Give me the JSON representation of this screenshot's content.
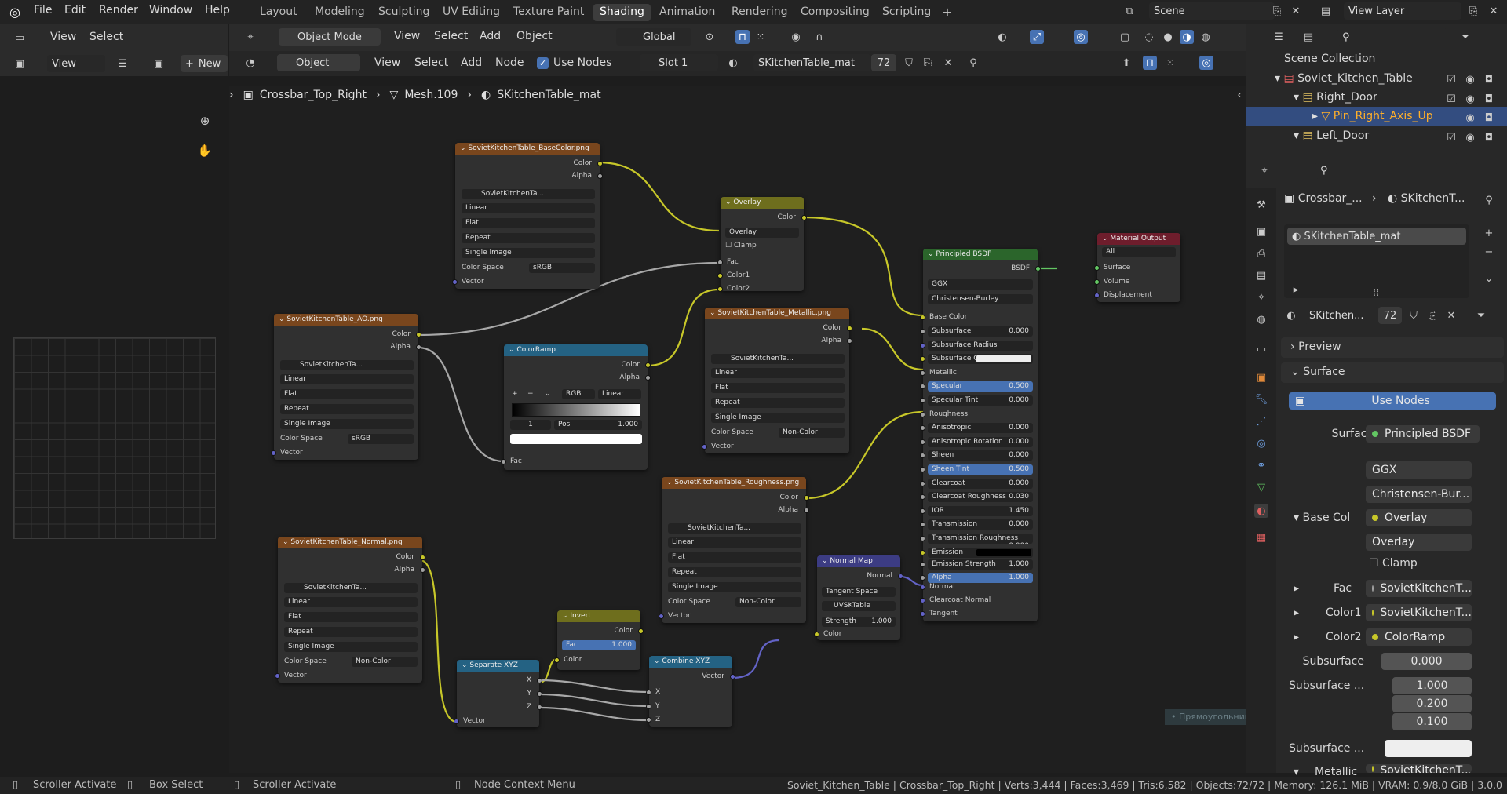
{
  "top_menu": [
    "File",
    "Edit",
    "Render",
    "Window",
    "Help"
  ],
  "workspaces": [
    "Layout",
    "Modeling",
    "Sculpting",
    "UV Editing",
    "Texture Paint",
    "Shading",
    "Animation",
    "Rendering",
    "Compositing",
    "Scripting"
  ],
  "active_workspace": "Shading",
  "scene": "Scene",
  "view_layer": "View Layer",
  "left_header": {
    "view": "View",
    "select": "Select",
    "view2": "View",
    "new": "New"
  },
  "viewport_header": {
    "mode": "Object Mode",
    "menus": [
      "View",
      "Select",
      "Add",
      "Object"
    ],
    "transform": "Global"
  },
  "node_header": {
    "type": "Object",
    "menus": [
      "View",
      "Select",
      "Add",
      "Node"
    ],
    "use_nodes": "Use Nodes",
    "slot": "Slot 1",
    "material": "SKitchenTable_mat",
    "users": "72"
  },
  "breadcrumb": {
    "object": "Crossbar_Top_Right",
    "mesh": "Mesh.109",
    "material": "SKitchenTable_mat"
  },
  "nodes": {
    "basecolor": {
      "title": "SovietKitchenTable_BaseColor.png",
      "out1": "Color",
      "out2": "Alpha",
      "img": "SovietKitchenTa...",
      "interp": "Linear",
      "proj": "Flat",
      "ext": "Repeat",
      "src": "Single Image",
      "cs_label": "Color Space",
      "cs": "sRGB",
      "vec": "Vector"
    },
    "ao": {
      "title": "SovietKitchenTable_AO.png",
      "out1": "Color",
      "out2": "Alpha",
      "img": "SovietKitchenTa...",
      "interp": "Linear",
      "proj": "Flat",
      "ext": "Repeat",
      "src": "Single Image",
      "cs_label": "Color Space",
      "cs": "sRGB",
      "vec": "Vector"
    },
    "normal": {
      "title": "SovietKitchenTable_Normal.png",
      "out1": "Color",
      "out2": "Alpha",
      "img": "SovietKitchenTa...",
      "interp": "Linear",
      "proj": "Flat",
      "ext": "Repeat",
      "src": "Single Image",
      "cs_label": "Color Space",
      "cs": "Non-Color",
      "vec": "Vector"
    },
    "metallic": {
      "title": "SovietKitchenTable_Metallic.png",
      "out1": "Color",
      "out2": "Alpha",
      "img": "SovietKitchenTa...",
      "interp": "Linear",
      "proj": "Flat",
      "ext": "Repeat",
      "src": "Single Image",
      "cs_label": "Color Space",
      "cs": "Non-Color",
      "vec": "Vector"
    },
    "roughness": {
      "title": "SovietKitchenTable_Roughness.png",
      "out1": "Color",
      "out2": "Alpha",
      "img": "SovietKitchenTa...",
      "interp": "Linear",
      "proj": "Flat",
      "ext": "Repeat",
      "src": "Single Image",
      "cs_label": "Color Space",
      "cs": "Non-Color",
      "vec": "Vector"
    },
    "overlay": {
      "title": "Overlay",
      "out": "Color",
      "blend": "Overlay",
      "clamp": "Clamp",
      "fac": "Fac",
      "c1": "Color1",
      "c2": "Color2"
    },
    "colorramp": {
      "title": "ColorRamp",
      "out1": "Color",
      "out2": "Alpha",
      "mode": "RGB",
      "interp": "Linear",
      "idx": "1",
      "pos_label": "Pos",
      "pos": "1.000",
      "fac": "Fac"
    },
    "invert": {
      "title": "Invert",
      "out": "Color",
      "fac_label": "Fac",
      "fac": "1.000",
      "color": "Color"
    },
    "separate": {
      "title": "Separate XYZ",
      "x": "X",
      "y": "Y",
      "z": "Z",
      "vec": "Vector"
    },
    "combine": {
      "title": "Combine XYZ",
      "vec": "Vector",
      "x": "X",
      "y": "Y",
      "z": "Z"
    },
    "normalmap": {
      "title": "Normal Map",
      "out": "Normal",
      "space": "Tangent Space",
      "uv": "UVSKTable",
      "str_label": "Strength",
      "str": "1.000",
      "color": "Color"
    },
    "bsdf": {
      "title": "Principled BSDF",
      "out": "BSDF",
      "dist": "GGX",
      "sss": "Christensen-Burley",
      "base": "Base Color",
      "fields": [
        [
          "Subsurface",
          "0.000",
          false
        ],
        [
          "Subsurface Radius",
          "",
          false
        ],
        [
          "Subsurface Co...",
          "",
          false
        ],
        [
          "Metallic",
          "",
          false
        ],
        [
          "Specular",
          "0.500",
          true
        ],
        [
          "Specular Tint",
          "0.000",
          false
        ],
        [
          "Roughness",
          "",
          false
        ],
        [
          "Anisotropic",
          "0.000",
          false
        ],
        [
          "Anisotropic Rotation",
          "0.000",
          false
        ],
        [
          "Sheen",
          "0.000",
          false
        ],
        [
          "Sheen Tint",
          "0.500",
          true
        ],
        [
          "Clearcoat",
          "0.000",
          false
        ],
        [
          "Clearcoat Roughness",
          "0.030",
          false
        ],
        [
          "IOR",
          "1.450",
          false
        ],
        [
          "Transmission",
          "0.000",
          false
        ],
        [
          "Transmission Roughness",
          "0.000",
          false
        ],
        [
          "Emission",
          "",
          false
        ],
        [
          "Emission Strength",
          "1.000",
          false
        ],
        [
          "Alpha",
          "1.000",
          true
        ]
      ],
      "normal": "Normal",
      "cc_normal": "Clearcoat Normal",
      "tangent": "Tangent"
    },
    "output": {
      "title": "Material Output",
      "target": "All",
      "surface": "Surface",
      "volume": "Volume",
      "disp": "Displacement"
    }
  },
  "outliner": {
    "root": "Scene Collection",
    "items": [
      "Soviet_Kitchen_Table",
      "Right_Door",
      "Pin_Right_Axis_Up",
      "Left_Door"
    ]
  },
  "properties": {
    "breadcrumb1": "Crossbar_...",
    "breadcrumb2": "SKitchenT...",
    "material_slot": "SKitchenTable_mat",
    "material_name": "SKitchen...",
    "users": "72",
    "preview": "Preview",
    "surface_panel": "Surface",
    "use_nodes": "Use Nodes",
    "surface_label": "Surface",
    "surface_val": "Principled BSDF",
    "dist": "GGX",
    "sss": "Christensen-Bur...",
    "base_col": "Base Col",
    "base_val": "Overlay",
    "blend": "Overlay",
    "clamp": "Clamp",
    "fac": "Fac",
    "fac_val": "SovietKitchenT...",
    "color1": "Color1",
    "color1_val": "SovietKitchenT...",
    "color2": "Color2",
    "color2_val": "ColorRamp",
    "subsurface": "Subsurface",
    "subsurface_val": "0.000",
    "subsurface_r": "Subsurface ...",
    "r1": "1.000",
    "r2": "0.200",
    "r3": "0.100",
    "subsurface_c": "Subsurface ...",
    "metallic": "Metallic",
    "metallic_val": "SovietKitchenT...",
    "tooltip": "Прямоугольник"
  },
  "status": {
    "a": "Scroller Activate",
    "b": "Box Select",
    "c": "Scroller Activate",
    "d": "Node Context Menu",
    "info": "Soviet_Kitchen_Table | Crossbar_Top_Right | Verts:3,444 | Faces:3,469 | Tris:6,582 | Objects:72/72 | Memory: 126.1 MiB | VRAM: 0.9/8.0 GiB | 3.0.0"
  },
  "colors": {
    "accent": "#4772b3",
    "tex_header": "#79461d",
    "conv_header": "#246283",
    "color_header": "#6e6e1d",
    "vec_header": "#3c3c83",
    "shader_header": "#2b652b",
    "output_header": "#6e1d2c"
  }
}
